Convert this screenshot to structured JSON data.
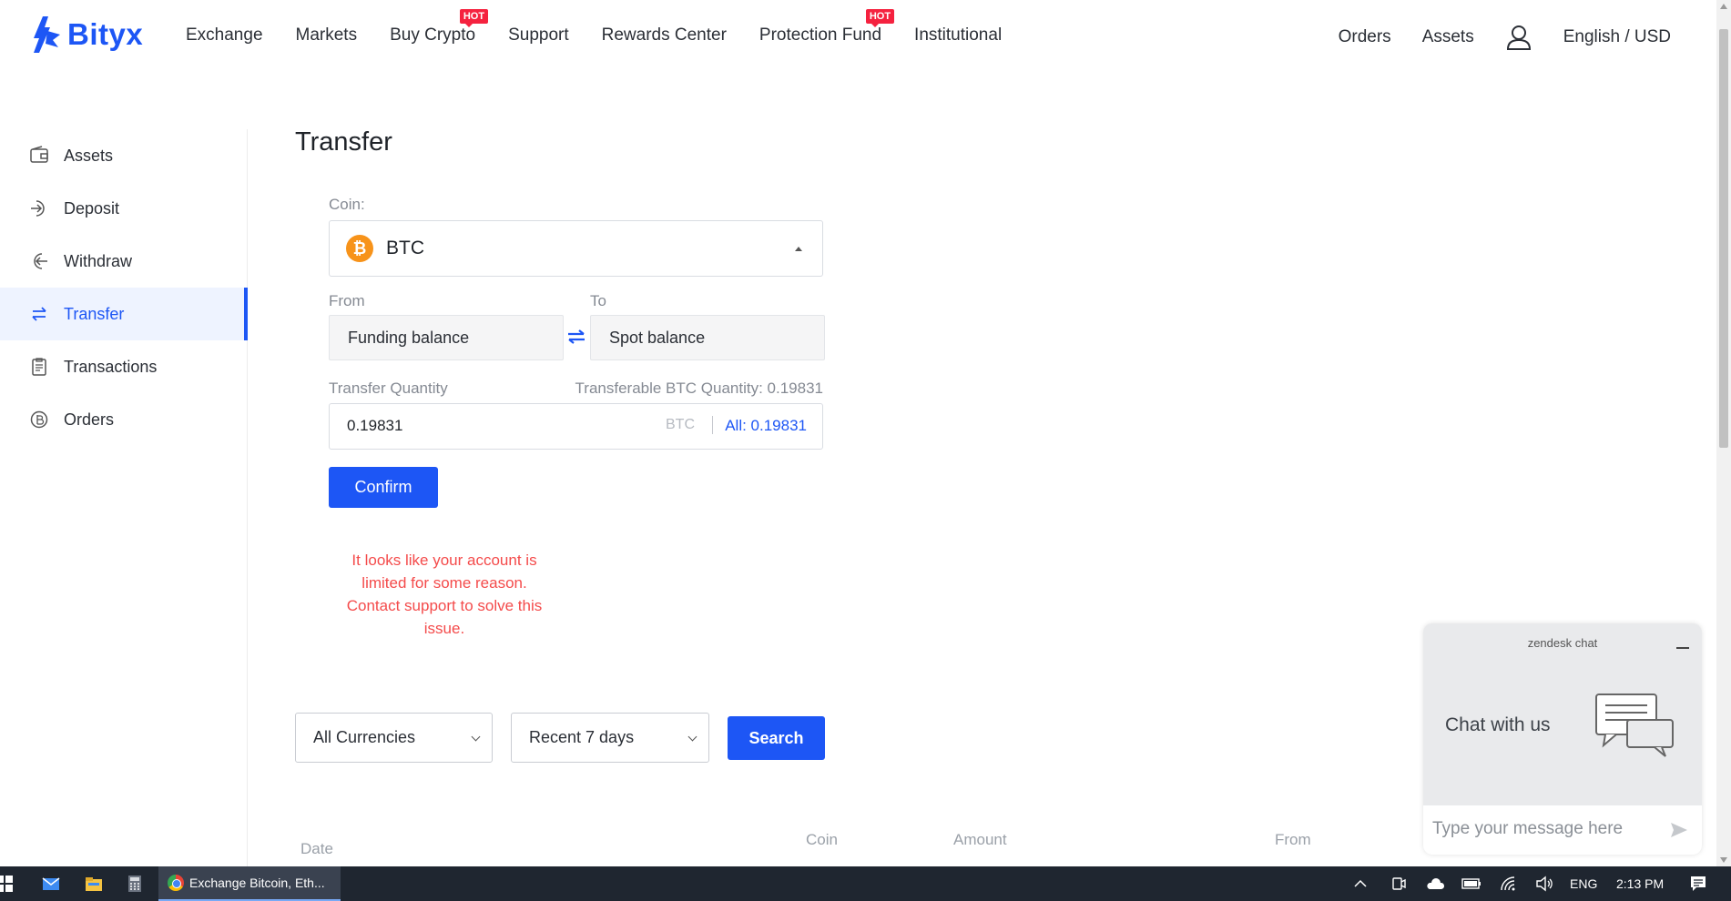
{
  "app": {
    "brand": "Bityx",
    "brand_color": "#1d56f5"
  },
  "nav": {
    "items": [
      {
        "label": "Exchange",
        "hot": false
      },
      {
        "label": "Markets",
        "hot": false
      },
      {
        "label": "Buy Crypto",
        "hot": true
      },
      {
        "label": "Support",
        "hot": false
      },
      {
        "label": "Rewards Center",
        "hot": false
      },
      {
        "label": "Protection Fund",
        "hot": true
      },
      {
        "label": "Institutional",
        "hot": false
      }
    ],
    "hot_label": "HOT",
    "right": {
      "orders": "Orders",
      "assets": "Assets",
      "locale": "English / USD"
    }
  },
  "sidebar": {
    "items": [
      {
        "label": "Assets",
        "icon": "wallet-icon",
        "active": false
      },
      {
        "label": "Deposit",
        "icon": "deposit-icon",
        "active": false
      },
      {
        "label": "Withdraw",
        "icon": "withdraw-icon",
        "active": false
      },
      {
        "label": "Transfer",
        "icon": "transfer-icon",
        "active": true
      },
      {
        "label": "Transactions",
        "icon": "clipboard-icon",
        "active": false
      },
      {
        "label": "Orders",
        "icon": "orders-icon",
        "active": false
      }
    ]
  },
  "transfer": {
    "title": "Transfer",
    "coin_label": "Coin:",
    "coin": {
      "symbol": "BTC",
      "icon": "bitcoin-icon",
      "icon_color": "#f7931a"
    },
    "from_label": "From",
    "to_label": "To",
    "from_value": "Funding balance",
    "to_value": "Spot balance",
    "quantity_label": "Transfer Quantity",
    "transferable_text": "Transferable BTC Quantity: 0.19831",
    "quantity_value": "0.19831",
    "quantity_unit": "BTC",
    "all_text": "All: 0.19831",
    "confirm_label": "Confirm",
    "error": "It looks like your account is limited for some reason. Contact support to solve this issue.",
    "error_color": "#f44b4b"
  },
  "filters": {
    "currency": "All Currencies",
    "period": "Recent 7 days",
    "search_label": "Search"
  },
  "table": {
    "columns": [
      "Date",
      "Coin",
      "Amount",
      "From"
    ]
  },
  "chat": {
    "header": "zendesk chat",
    "title": "Chat with us",
    "placeholder": "Type your message here"
  },
  "taskbar": {
    "app_title": "Exchange Bitcoin, Eth...",
    "lang": "ENG",
    "time": "2:13 PM"
  }
}
